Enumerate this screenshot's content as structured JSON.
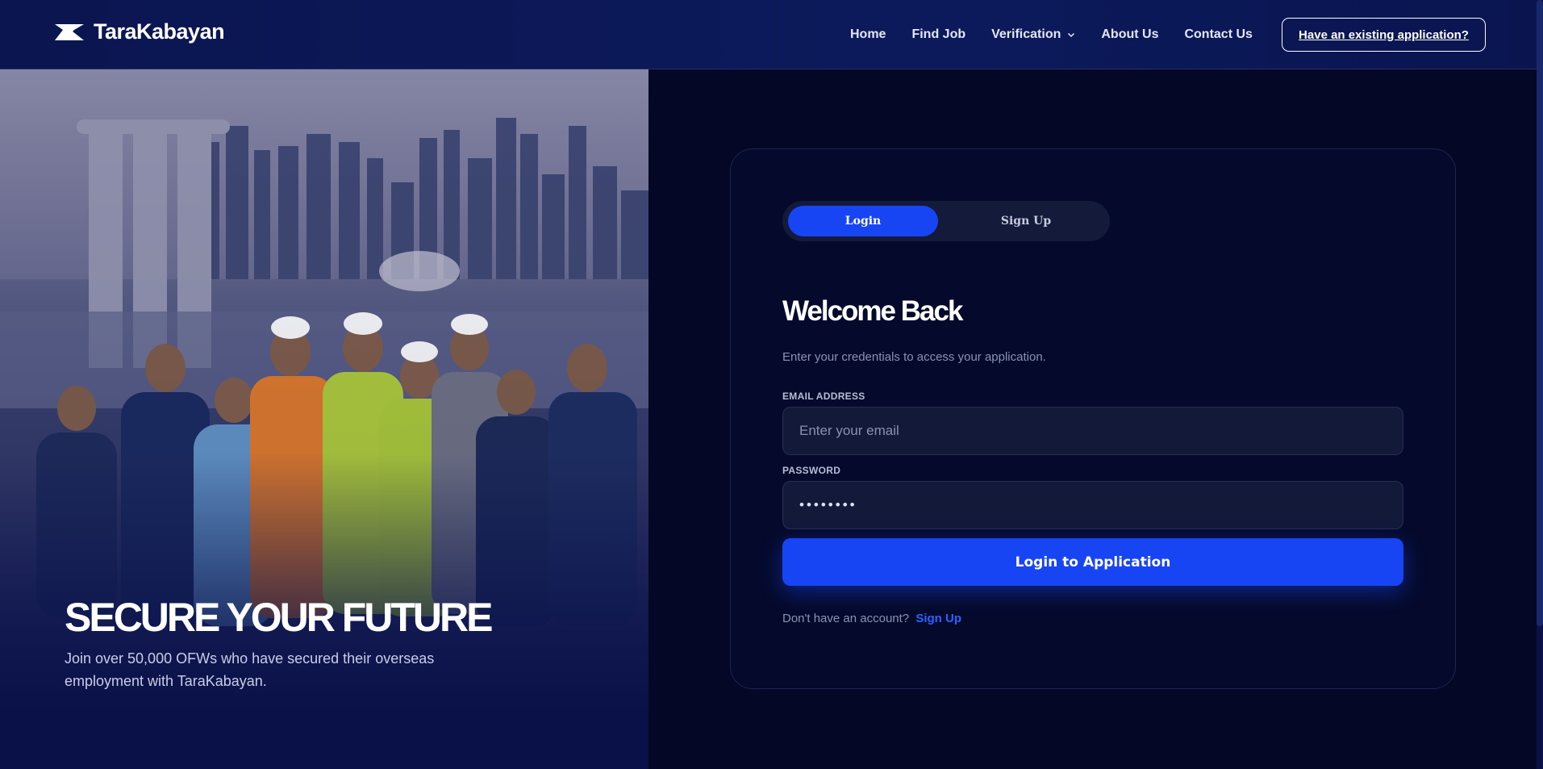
{
  "brand": {
    "name": "TaraKabayan",
    "logo_icon": "brand-mark-icon"
  },
  "nav": {
    "items": [
      {
        "label": "Home"
      },
      {
        "label": "Find Job"
      },
      {
        "label": "Verification",
        "icon": "chevron-down-icon"
      },
      {
        "label": "About Us"
      },
      {
        "label": "Contact Us"
      }
    ],
    "cta_label": "Have an existing application?"
  },
  "hero": {
    "title": "SECURE YOUR FUTURE",
    "subtitle": "Join over 50,000 OFWs who have secured their overseas employment with TaraKabayan."
  },
  "auth": {
    "tabs": {
      "login": "Login",
      "signup": "Sign Up"
    },
    "heading": "Welcome Back",
    "subheading": "Enter your credentials to access your application.",
    "email": {
      "label": "EMAIL ADDRESS",
      "placeholder": "Enter your email",
      "value": ""
    },
    "password": {
      "label": "PASSWORD",
      "value": "••••••••"
    },
    "submit_label": "Login to Application",
    "footer": {
      "prompt": "Don't have an account?",
      "link": "Sign Up"
    }
  },
  "colors": {
    "accent": "#1745f4",
    "link": "#2a62ff",
    "header_bg": "#0c1a5c",
    "page_bg": "#040826"
  }
}
